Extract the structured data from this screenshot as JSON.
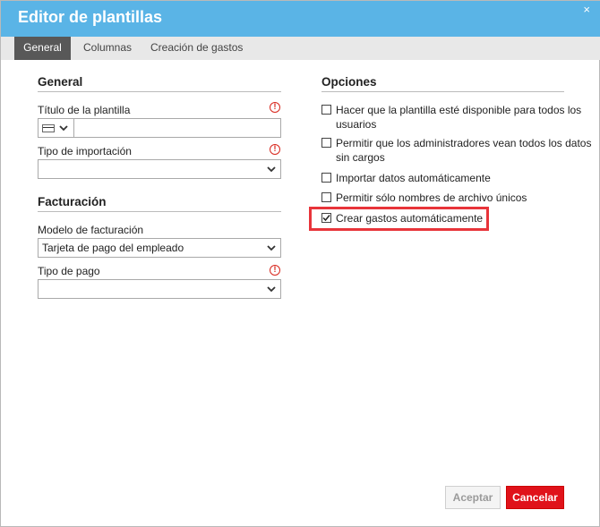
{
  "window": {
    "title": "Editor de plantillas",
    "close_symbol": "×"
  },
  "tabs": [
    {
      "label": "General",
      "active": true
    },
    {
      "label": "Columnas",
      "active": false
    },
    {
      "label": "Creación de gastos",
      "active": false
    }
  ],
  "general": {
    "heading": "General",
    "template_title_label": "Título de la plantilla",
    "template_title_value": "",
    "import_type_label": "Tipo de importación",
    "import_type_value": ""
  },
  "billing": {
    "heading": "Facturación",
    "model_label": "Modelo de facturación",
    "model_value": "Tarjeta de pago del empleado",
    "payment_type_label": "Tipo de pago",
    "payment_type_value": ""
  },
  "options": {
    "heading": "Opciones",
    "items": [
      {
        "label": "Hacer que la plantilla esté disponible para todos los usuarios",
        "checked": false
      },
      {
        "label": "Permitir que los administradores vean todos los datos sin cargos",
        "checked": false
      },
      {
        "label": "Importar datos automáticamente",
        "checked": false
      },
      {
        "label": "Permitir sólo nombres de archivo únicos",
        "checked": false
      },
      {
        "label": "Crear gastos automáticamente",
        "checked": true
      }
    ]
  },
  "buttons": {
    "accept": "Aceptar",
    "cancel": "Cancelar"
  },
  "required_symbol": "!",
  "colors": {
    "titlebar": "#5ab4e6",
    "cancel": "#e0121a",
    "required": "#d8261c",
    "highlight": "#e8343a"
  }
}
